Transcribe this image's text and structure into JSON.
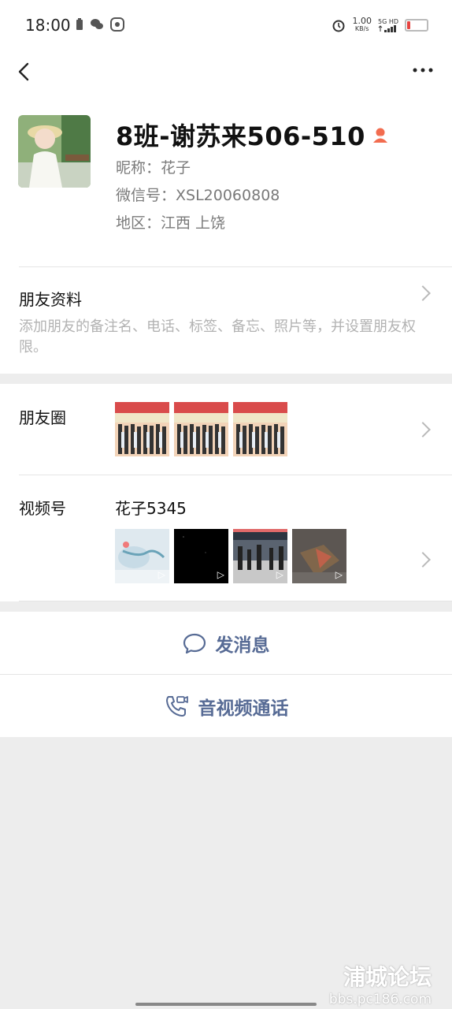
{
  "status_bar": {
    "time": "18:00",
    "net_speed": "1.00",
    "net_unit": "KB/s",
    "network": "5G HD"
  },
  "profile": {
    "name": "8班-谢苏来506-510",
    "nickname": "昵称：花子",
    "wechat_id": "微信号：XSL20060808",
    "region": "地区：江西  上饶"
  },
  "friend_info": {
    "title": "朋友资料",
    "description": "添加朋友的备注名、电话、标签、备忘、照片等，并设置朋友权限。"
  },
  "moments": {
    "label": "朋友圈"
  },
  "channels": {
    "label": "视频号",
    "name": "花子5345"
  },
  "actions": {
    "message": "发消息",
    "call": "音视频通话"
  },
  "watermark": {
    "line1": "浦城论坛",
    "line2": "bbs.pc186.com"
  },
  "colors": {
    "link": "#576b95",
    "background": "#ededed",
    "gender_icon": "#f26c4f"
  }
}
